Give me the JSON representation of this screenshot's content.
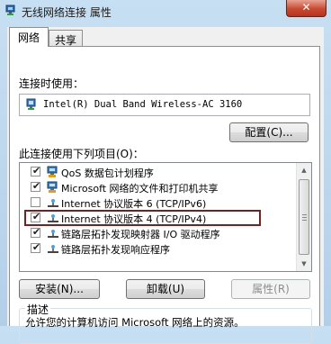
{
  "window": {
    "title": "无线网络连接 属性"
  },
  "tabs": [
    {
      "label": "网络"
    },
    {
      "label": "共享"
    }
  ],
  "connect_using": {
    "label": "连接时使用：",
    "adapter": "Intel(R) Dual Band Wireless-AC 3160",
    "configure_button": "配置(C)..."
  },
  "items_section": {
    "label": "此连接使用下列项目(O)：",
    "items": [
      {
        "label": "QoS 数据包计划程序",
        "checked": true
      },
      {
        "label": "Microsoft 网络的文件和打印机共享",
        "checked": true
      },
      {
        "label": "Internet 协议版本 6 (TCP/IPv6)",
        "checked": false
      },
      {
        "label": "Internet 协议版本 4 (TCP/IPv4)",
        "checked": true
      },
      {
        "label": "链路层拓扑发现映射器 I/O 驱动程序",
        "checked": true
      },
      {
        "label": "链路层拓扑发现响应程序",
        "checked": true
      }
    ]
  },
  "buttons": {
    "install": "安装(N)...",
    "uninstall": "卸载(U)",
    "properties": "属性(R)"
  },
  "description": {
    "title": "描述",
    "text": "允许您的计算机访问 Microsoft 网络上的资源。"
  },
  "icons": {
    "window": "network-adapter-icon",
    "close": "close-icon",
    "adapter": "network-adapter-icon",
    "client": "network-client-icon",
    "protocol": "protocol-icon",
    "check": "✔"
  },
  "colors": {
    "titlebar": "#c7dff2",
    "close_button": "#c84a32",
    "highlight_frame": "#7a1f1f"
  }
}
